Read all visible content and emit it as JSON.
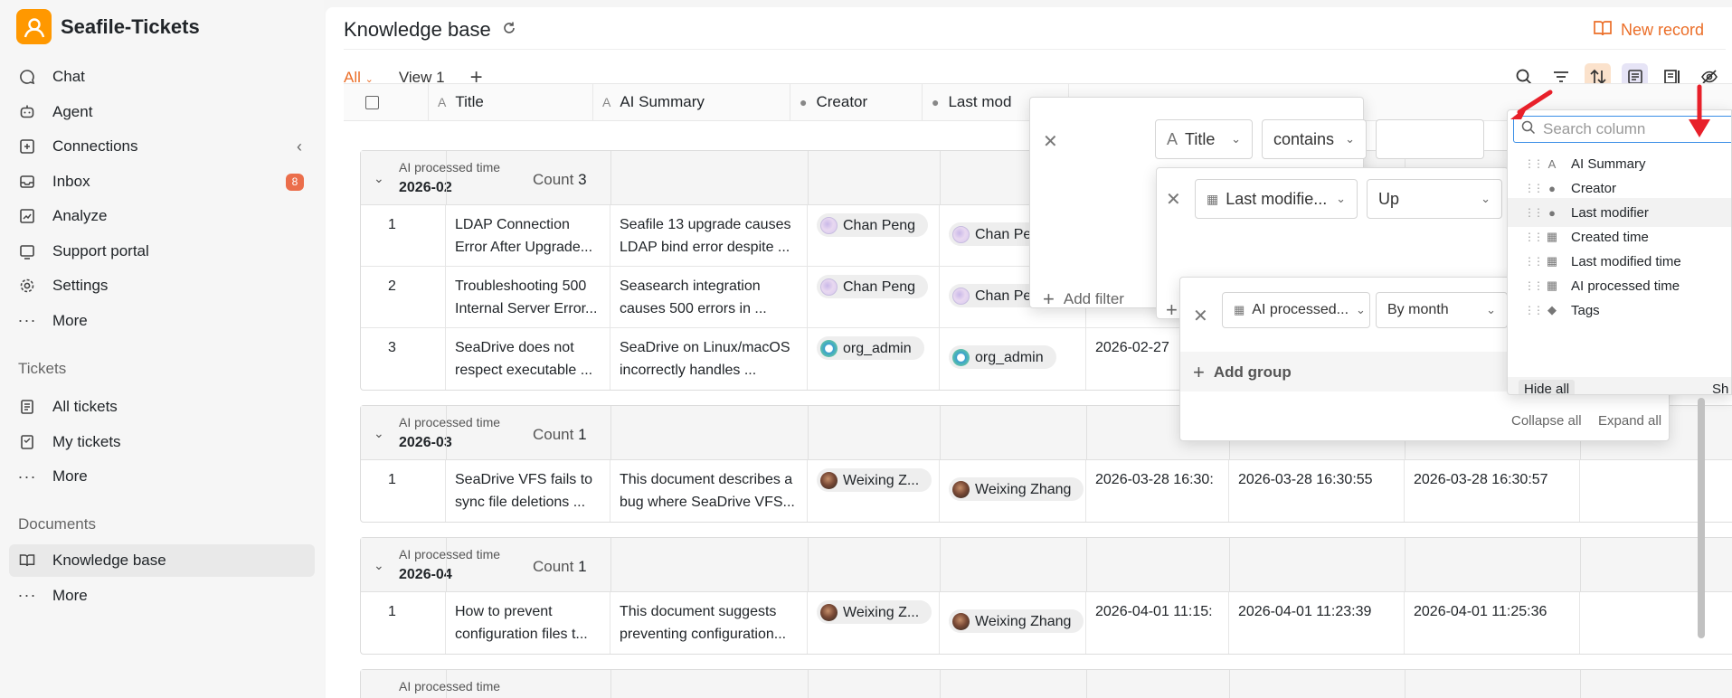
{
  "app": {
    "name": "Seafile-Tickets"
  },
  "sidebar": {
    "nav": [
      {
        "label": "Chat",
        "icon": "chat-icon"
      },
      {
        "label": "Agent",
        "icon": "agent-icon"
      },
      {
        "label": "Connections",
        "icon": "connections-icon"
      },
      {
        "label": "Inbox",
        "icon": "inbox-icon",
        "badge": "8"
      },
      {
        "label": "Analyze",
        "icon": "analyze-icon"
      },
      {
        "label": "Support portal",
        "icon": "portal-icon"
      },
      {
        "label": "Settings",
        "icon": "gear-icon"
      },
      {
        "label": "More",
        "icon": "more-icon"
      }
    ],
    "tickets_title": "Tickets",
    "tickets": [
      {
        "label": "All tickets",
        "icon": "tickets-icon"
      },
      {
        "label": "My tickets",
        "icon": "my-tickets-icon"
      },
      {
        "label": "More",
        "icon": "more-icon"
      }
    ],
    "documents_title": "Documents",
    "documents": [
      {
        "label": "Knowledge base",
        "icon": "book-icon",
        "active": true
      },
      {
        "label": "More",
        "icon": "more-icon"
      }
    ]
  },
  "header": {
    "title": "Knowledge base",
    "new_record": "New record"
  },
  "tabs": {
    "all": "All",
    "view1": "View 1"
  },
  "columns": [
    "Title",
    "AI Summary",
    "Creator",
    "Last mod"
  ],
  "groups": [
    {
      "label": "AI processed time",
      "value": "2026-02",
      "count_label": "Count",
      "count": "3",
      "rows": [
        {
          "idx": "1",
          "title": [
            "LDAP Connection",
            "Error After Upgrade..."
          ],
          "summary": [
            "Seafile 13 upgrade causes",
            "LDAP bind error despite ..."
          ],
          "creator": "Chan Peng",
          "creator_av": "cp",
          "modifier": "Chan Pen",
          "modifier_av": "cp",
          "d1": "",
          "d2": "",
          "d3": ""
        },
        {
          "idx": "2",
          "title": [
            "Troubleshooting 500",
            "Internal Server Error..."
          ],
          "summary": [
            "Seasearch integration",
            "causes 500 errors in ..."
          ],
          "creator": "Chan Peng",
          "creator_av": "cp",
          "modifier": "Chan Pen",
          "modifier_av": "cp",
          "d1": "",
          "d2": "",
          "d3": ""
        },
        {
          "idx": "3",
          "title": [
            "SeaDrive does not",
            "respect executable ..."
          ],
          "summary": [
            "SeaDrive on Linux/macOS",
            "incorrectly handles ..."
          ],
          "creator": "org_admin",
          "creator_av": "oa",
          "modifier": "org_admin",
          "modifier_av": "oa",
          "d1": "2026-02-27",
          "d2": "",
          "d3": ""
        }
      ]
    },
    {
      "label": "AI processed time",
      "value": "2026-03",
      "count_label": "Count",
      "count": "1",
      "rows": [
        {
          "idx": "1",
          "title": [
            "SeaDrive VFS fails to",
            "sync file deletions ..."
          ],
          "summary": [
            "This document describes a",
            "bug where SeaDrive VFS..."
          ],
          "creator": "Weixing Z...",
          "creator_av": "wz",
          "modifier": "Weixing Zhang",
          "modifier_av": "wz",
          "d1": "2026-03-28 16:30:",
          "d2": "2026-03-28 16:30:55",
          "d3": "2026-03-28 16:30:57"
        }
      ]
    },
    {
      "label": "AI processed time",
      "value": "2026-04",
      "count_label": "Count",
      "count": "1",
      "rows": [
        {
          "idx": "1",
          "title": [
            "How to prevent",
            "configuration files t..."
          ],
          "summary": [
            "This document suggests",
            "preventing configuration..."
          ],
          "creator": "Weixing Z...",
          "creator_av": "wz",
          "modifier": "Weixing Zhang",
          "modifier_av": "wz",
          "d1": "2026-04-01 11:15:",
          "d2": "2026-04-01 11:23:39",
          "d3": "2026-04-01 11:25:36"
        }
      ]
    },
    {
      "label": "AI processed time",
      "value": "",
      "count_label": "",
      "count": "",
      "rows": []
    }
  ],
  "filter_popup": {
    "field": "Title",
    "operator": "contains",
    "value": "",
    "add_filter": "Add filter"
  },
  "sort_popup": {
    "field": "Last modifie...",
    "direction": "Up"
  },
  "group_popup": {
    "field": "AI processed...",
    "granularity": "By month",
    "add_group": "Add group",
    "collapse_all": "Collapse all",
    "expand_all": "Expand all"
  },
  "column_panel": {
    "search_placeholder": "Search column",
    "items": [
      {
        "label": "AI Summary",
        "icon": "text-icon"
      },
      {
        "label": "Creator",
        "icon": "user-icon"
      },
      {
        "label": "Last modifier",
        "icon": "user-icon",
        "highlight": true
      },
      {
        "label": "Created time",
        "icon": "calendar-icon"
      },
      {
        "label": "Last modified time",
        "icon": "calendar-icon"
      },
      {
        "label": "AI processed time",
        "icon": "calendar-icon"
      },
      {
        "label": "Tags",
        "icon": "tag-icon"
      }
    ],
    "hide_all": "Hide all",
    "show_all": "Sh"
  },
  "colors": {
    "accent": "#eb6e28",
    "badge": "#eb6e4b",
    "arrow": "#e8202a"
  }
}
